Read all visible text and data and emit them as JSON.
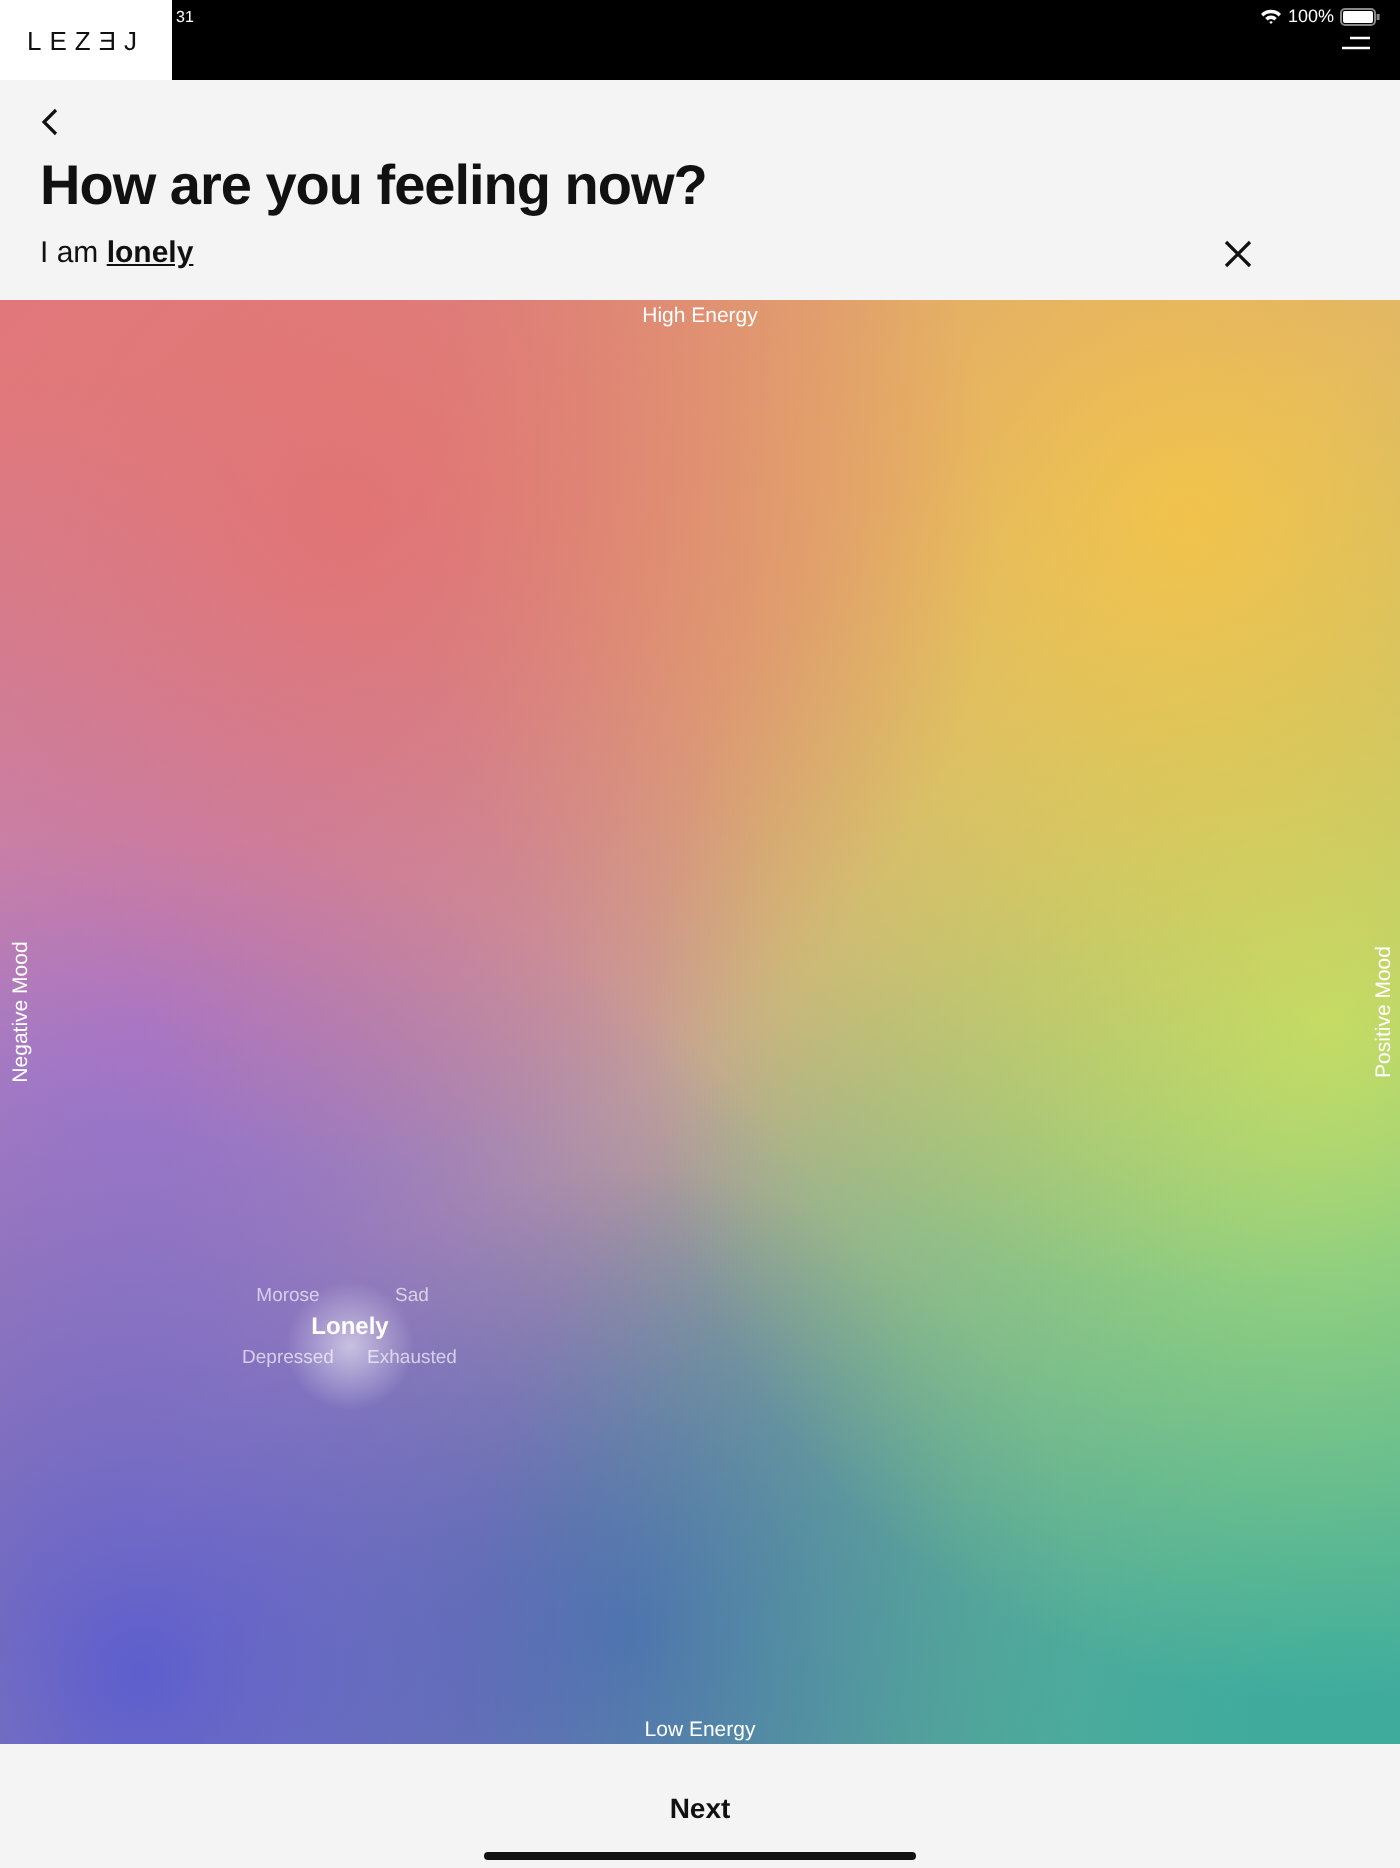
{
  "status_bar": {
    "time": "31",
    "battery": "100%"
  },
  "logo": "LEZƎJ",
  "title": "How are you feeling now?",
  "statement": "I am **lonely**",
  "mood_map": {
    "top_label": "High Energy",
    "bottom_label": "Low Energy",
    "left_label": "Negative Mood",
    "right_label": "Positive Mood",
    "words": [
      {
        "label": "Morose",
        "selected": false
      },
      {
        "label": "Sad",
        "selected": false
      },
      {
        "label": "Lonely",
        "selected": true
      },
      {
        "label": "Depressed",
        "selected": false
      },
      {
        "label": "Exhausted",
        "selected": false
      }
    ]
  },
  "next_button": "Next"
}
